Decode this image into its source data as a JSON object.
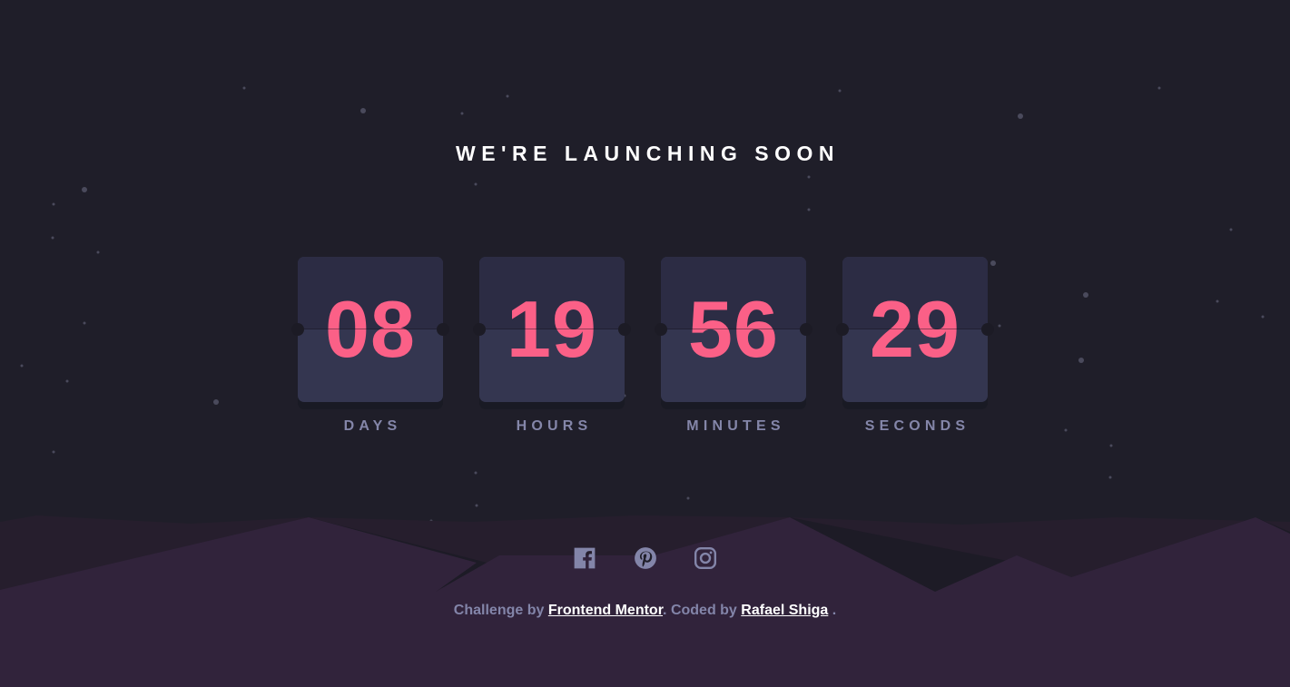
{
  "header": {
    "title": "WE'RE LAUNCHING SOON"
  },
  "countdown": [
    {
      "value": "08",
      "label": "DAYS"
    },
    {
      "value": "19",
      "label": "HOURS"
    },
    {
      "value": "56",
      "label": "MINUTES"
    },
    {
      "value": "29",
      "label": "SECONDS"
    }
  ],
  "social": [
    {
      "icon": "facebook-icon"
    },
    {
      "icon": "pinterest-icon"
    },
    {
      "icon": "instagram-icon"
    }
  ],
  "footer": {
    "challenge_prefix": "Challenge by ",
    "frontend_mentor": "Frontend Mentor",
    "coded_by": ". Coded by ",
    "author": "Rafael Shiga",
    "suffix": " ."
  },
  "colors": {
    "background": "#1f1e29",
    "card": "#343650",
    "digits": "#fb6087",
    "label": "#8486a9",
    "hills": "#31233b"
  }
}
